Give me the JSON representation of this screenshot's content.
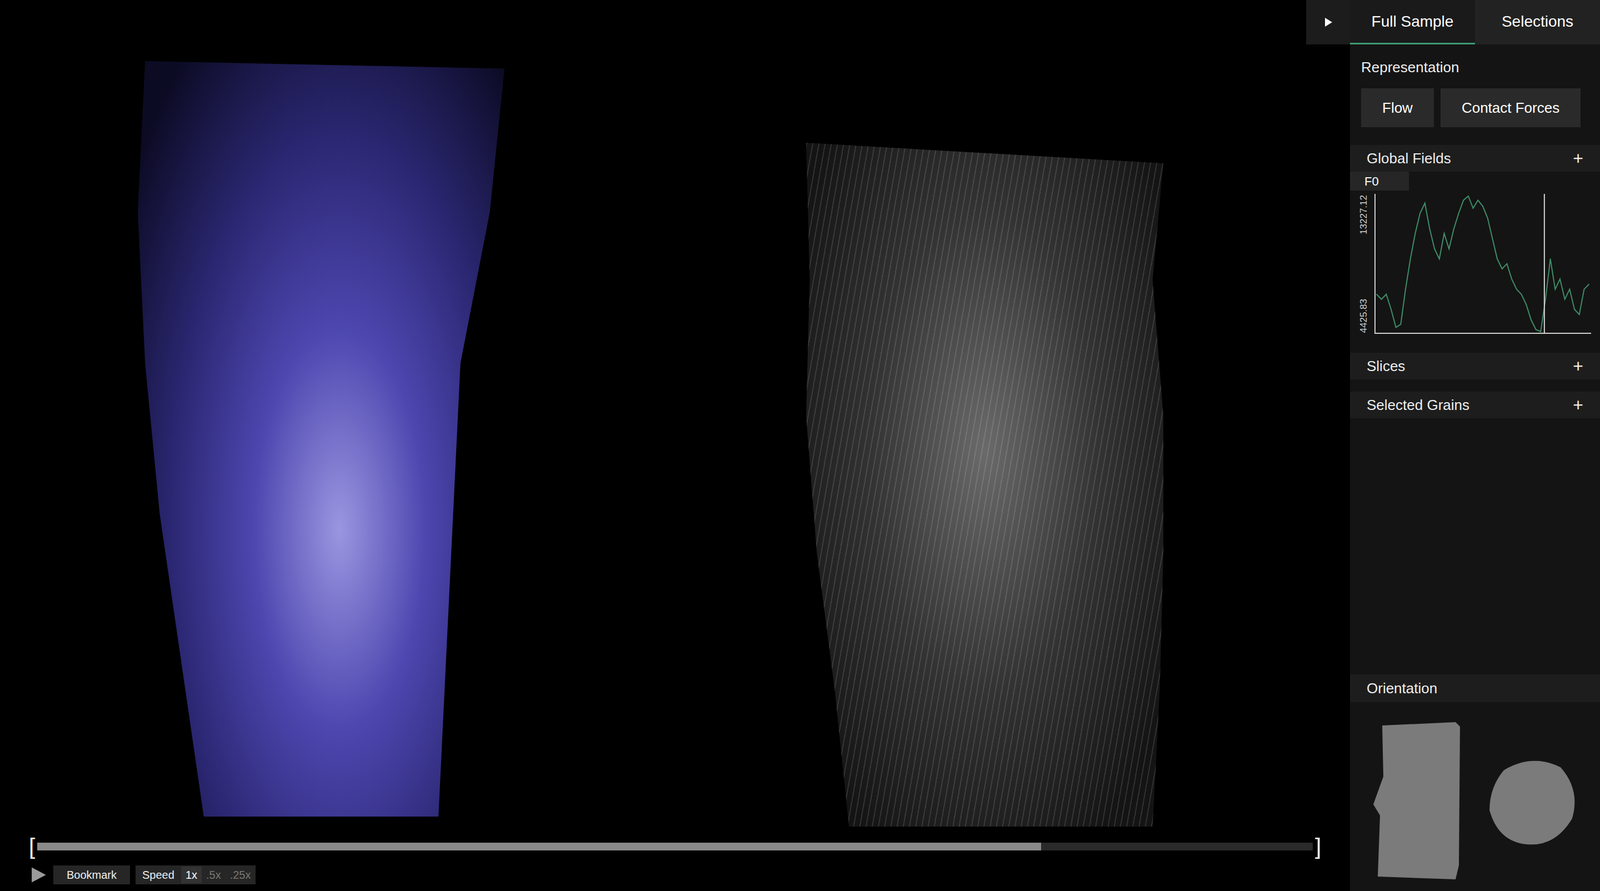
{
  "tabs": [
    {
      "label": "Full Sample",
      "selected": true
    },
    {
      "label": "Selections",
      "selected": false
    }
  ],
  "representation": {
    "label": "Representation",
    "options": [
      {
        "label": "Flow",
        "selected": false
      },
      {
        "label": "Contact Forces",
        "selected": false
      }
    ]
  },
  "global_fields": {
    "label": "Global Fields",
    "toggle": "+",
    "field_tabs": [
      {
        "label": "F0",
        "selected": true
      }
    ],
    "chart": {
      "y_max": "13227.12",
      "y_min": "4425.83",
      "cursor_level": 0.79,
      "series": [
        6854,
        6526,
        6854,
        5868,
        4700,
        4900,
        7200,
        9150,
        10800,
        12110,
        12770,
        11100,
        9800,
        9150,
        10800,
        9800,
        11100,
        12110,
        12960,
        13227,
        12440,
        12960,
        12570,
        11800,
        10470,
        9150,
        8500,
        8830,
        7840,
        7180,
        6850,
        6190,
        5200,
        4560,
        4426,
        6530,
        9150,
        7180,
        7840,
        6530,
        7180,
        5870,
        5540,
        7180,
        7500
      ]
    }
  },
  "sections": [
    {
      "label": "Slices",
      "toggle": "+"
    },
    {
      "label": "Selected Grains",
      "toggle": "+"
    }
  ],
  "orientation": {
    "label": "Orientation"
  },
  "timeline": {
    "start_bracket": "[",
    "end_bracket": "]",
    "level": 0.787,
    "bookmark": "Bookmark",
    "speed_label": "Speed",
    "speeds": [
      {
        "label": "1x",
        "selected": true
      },
      {
        "label": ".5x",
        "selected": false
      },
      {
        "label": ".25x",
        "selected": false
      }
    ]
  }
}
